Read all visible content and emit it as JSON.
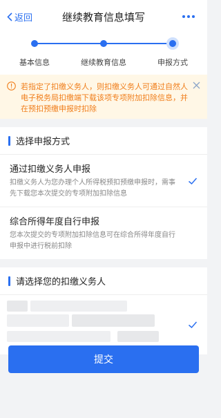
{
  "header": {
    "back_label": "返回",
    "title": "继续教育信息填写"
  },
  "steps": [
    {
      "label": "基本信息",
      "state": "done"
    },
    {
      "label": "继续教育信息",
      "state": "done"
    },
    {
      "label": "申报方式",
      "state": "active"
    }
  ],
  "notice": {
    "text": "若指定了扣缴义务人，则扣缴义务人可通过自然人电子税务局扣缴端下载该项专项附加扣除信息，并在预扣预缴申报时扣除"
  },
  "declare_section": {
    "title": "选择申报方式",
    "options": [
      {
        "title": "通过扣缴义务人申报",
        "desc": "扣缴义务人为您办理个人所得税预扣预缴申报时，需事先下载您本次提交的专项附加扣除信息",
        "selected": true
      },
      {
        "title": "综合所得年度自行申报",
        "desc": "您本次提交的专项附加扣除信息可在综合所得年度自行申报中进行税前扣除",
        "selected": false
      }
    ]
  },
  "agent_section": {
    "title": "请选择您的扣缴义务人",
    "selected": true
  },
  "submit_label": "提交",
  "colors": {
    "accent": "#2a6ff0",
    "notice_text": "#f07e1b",
    "notice_bg": "#fff7e6"
  }
}
